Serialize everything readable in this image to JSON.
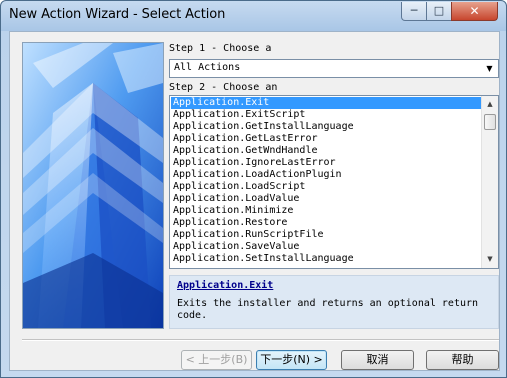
{
  "window": {
    "title": "New Action Wizard - Select Action",
    "controls": {
      "minimize": "─",
      "maximize": "□",
      "close": "✕"
    }
  },
  "step1": {
    "label": "Step 1 - Choose a",
    "selected": "All Actions",
    "arrow": "▼"
  },
  "step2": {
    "label": "Step 2 - Choose an",
    "items": [
      "Application.Exit",
      "Application.ExitScript",
      "Application.GetInstallLanguage",
      "Application.GetLastError",
      "Application.GetWndHandle",
      "Application.IgnoreLastError",
      "Application.LoadActionPlugin",
      "Application.LoadScript",
      "Application.LoadValue",
      "Application.Minimize",
      "Application.Restore",
      "Application.RunScriptFile",
      "Application.SaveValue",
      "Application.SetInstallLanguage"
    ],
    "selected_index": 0,
    "scroll_up": "▲",
    "scroll_down": "▼"
  },
  "description": {
    "title": "Application.Exit",
    "body": "Exits the installer and returns an optional return code."
  },
  "buttons": {
    "back": "< 上一步(B)",
    "next": "下一步(N) >",
    "cancel": "取消",
    "help": "帮助"
  },
  "colors": {
    "selection": "#3399ff",
    "description_bg": "#dde8f4",
    "link": "#00008b"
  }
}
